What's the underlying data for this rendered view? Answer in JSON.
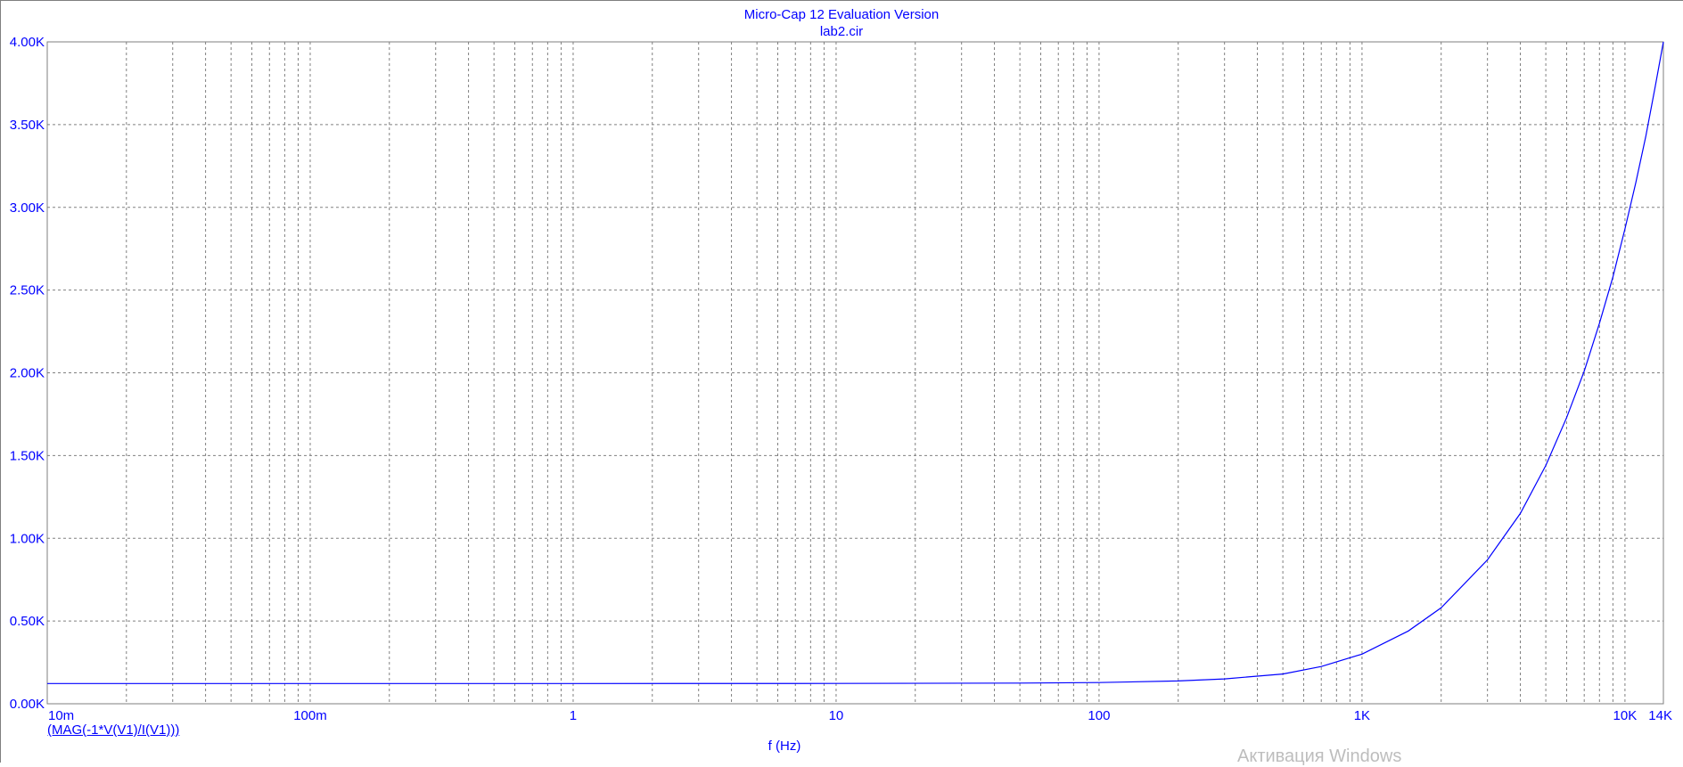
{
  "chart_data": {
    "type": "line",
    "title": "Micro-Cap 12 Evaluation Version",
    "subtitle": "lab2.cir",
    "xlabel": "f (Hz)",
    "ylabel": "",
    "x_scale": "log",
    "xlim": [
      0.01,
      14000
    ],
    "ylim": [
      0,
      4000
    ],
    "x_ticks": [
      {
        "value": 0.01,
        "label": "10m"
      },
      {
        "value": 0.1,
        "label": "100m"
      },
      {
        "value": 1,
        "label": "1"
      },
      {
        "value": 10,
        "label": "10"
      },
      {
        "value": 100,
        "label": "100"
      },
      {
        "value": 1000,
        "label": "1K"
      },
      {
        "value": 10000,
        "label": "10K"
      },
      {
        "value": 14000,
        "label": "14K"
      }
    ],
    "y_ticks": [
      {
        "value": 0,
        "label": "0.00K"
      },
      {
        "value": 500,
        "label": "0.50K"
      },
      {
        "value": 1000,
        "label": "1.00K"
      },
      {
        "value": 1500,
        "label": "1.50K"
      },
      {
        "value": 2000,
        "label": "2.00K"
      },
      {
        "value": 2500,
        "label": "2.50K"
      },
      {
        "value": 3000,
        "label": "3.00K"
      },
      {
        "value": 3500,
        "label": "3.50K"
      },
      {
        "value": 4000,
        "label": "4.00K"
      }
    ],
    "grid": true,
    "series": [
      {
        "name": "(MAG(-1*V(V1)/I(V1)))",
        "color": "#0000ff",
        "x": [
          0.01,
          0.1,
          1,
          10,
          50,
          100,
          200,
          300,
          500,
          700,
          1000,
          1500,
          2000,
          3000,
          4000,
          5000,
          6000,
          7000,
          8000,
          9000,
          10000,
          11000,
          12000,
          13000,
          14000
        ],
        "y": [
          122,
          122,
          122,
          123,
          125,
          128,
          138,
          150,
          180,
          225,
          300,
          440,
          580,
          870,
          1150,
          1440,
          1730,
          2010,
          2300,
          2580,
          2870,
          3150,
          3430,
          3720,
          4000
        ]
      }
    ]
  },
  "overlay": {
    "watermark": "Активация Windows"
  },
  "colors": {
    "axis": "#0000ff",
    "grid": "#808080",
    "frame": "#7f7f7f"
  }
}
